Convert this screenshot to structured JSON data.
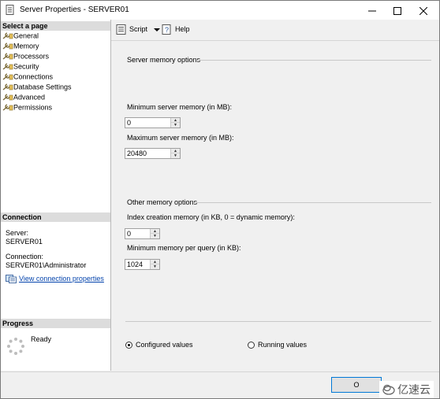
{
  "window": {
    "title": "Server Properties - SERVER01"
  },
  "sidebar": {
    "select_page_header": "Select a page",
    "pages": [
      {
        "label": "General"
      },
      {
        "label": "Memory"
      },
      {
        "label": "Processors"
      },
      {
        "label": "Security"
      },
      {
        "label": "Connections"
      },
      {
        "label": "Database Settings"
      },
      {
        "label": "Advanced"
      },
      {
        "label": "Permissions"
      }
    ],
    "connection_header": "Connection",
    "server_label": "Server:",
    "server_value": "SERVER01",
    "connection_label": "Connection:",
    "connection_value": "SERVER01\\Administrator",
    "view_link": "View connection properties",
    "progress_header": "Progress",
    "progress_status": "Ready"
  },
  "toolbar": {
    "script_label": "Script",
    "help_label": "Help"
  },
  "memory": {
    "group_title": "Server memory options",
    "min_label": "Minimum server memory (in MB):",
    "min_value": "0",
    "max_label": "Maximum server memory (in MB):",
    "max_value": "20480",
    "other_group_title": "Other memory options",
    "index_label": "Index creation memory (in KB, 0 = dynamic memory):",
    "index_value": "0",
    "query_label": "Minimum memory per query (in KB):",
    "query_value": "1024",
    "configured_label": "Configured values",
    "running_label": "Running values"
  },
  "buttons": {
    "ok_label": "O"
  },
  "watermark": {
    "text": "亿速云"
  }
}
